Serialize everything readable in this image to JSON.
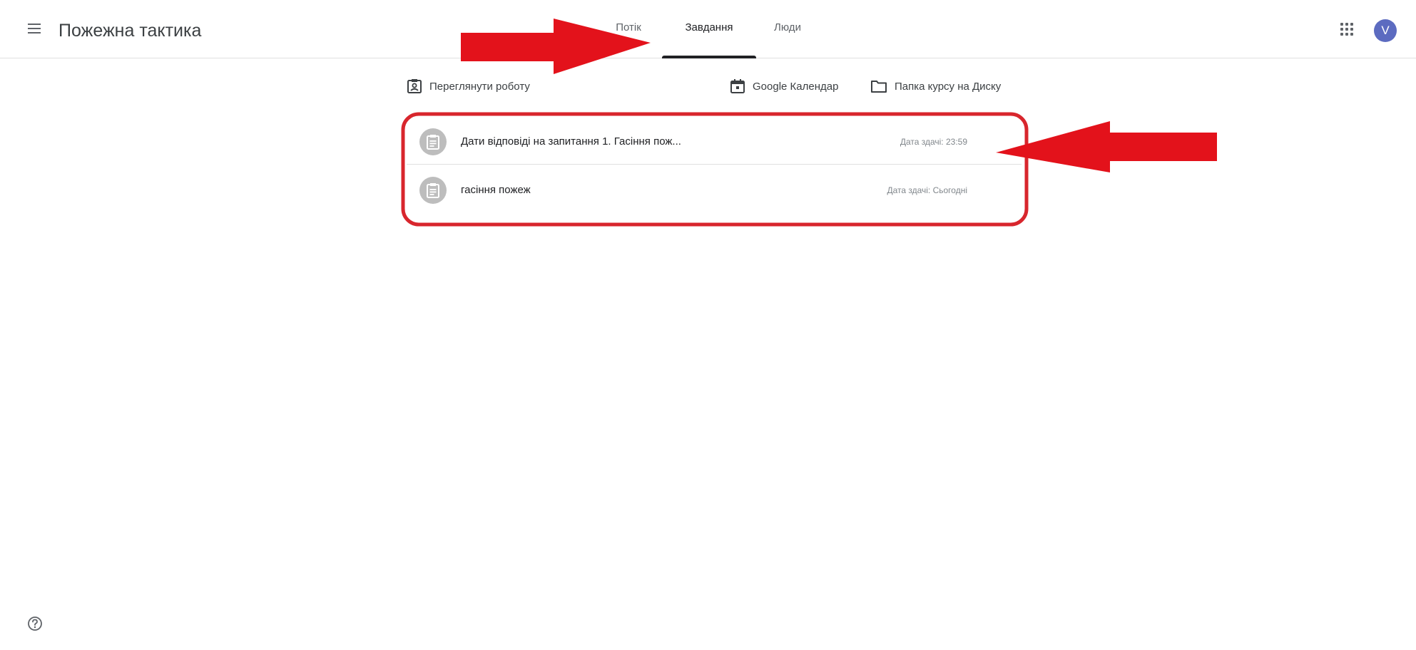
{
  "header": {
    "class_title": "Пожежна тактика",
    "tabs": [
      {
        "label": "Потік",
        "active": false
      },
      {
        "label": "Завдання",
        "active": true
      },
      {
        "label": "Люди",
        "active": false
      }
    ],
    "avatar_letter": "V"
  },
  "toolbar": {
    "view_work_label": "Переглянути роботу",
    "calendar_label": "Google Календар",
    "drive_folder_label": "Папка курсу на Диску"
  },
  "assignments": [
    {
      "title": "Дати відповіді на запитання 1. Гасіння пож...",
      "due": "Дата здачі: 23:59"
    },
    {
      "title": "гасіння пожеж",
      "due": "Дата здачі: Сьогодні"
    }
  ],
  "icons": [
    "menu-icon",
    "apps-grid-icon",
    "view-work-icon",
    "calendar-icon",
    "folder-icon",
    "assignment-icon",
    "help-icon"
  ],
  "colors": {
    "avatar_bg": "#5c6bc0",
    "annotation_red": "#e3121b",
    "tab_active": "#202124"
  }
}
